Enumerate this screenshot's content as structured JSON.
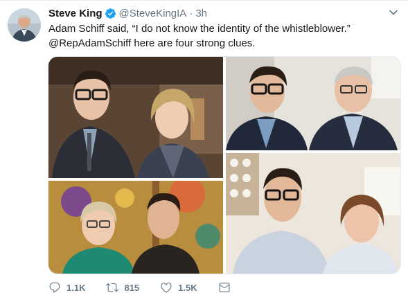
{
  "tweet": {
    "author_name": "Steve King",
    "handle": "@SteveKingIA",
    "separator": "·",
    "time": "3h",
    "verified": true,
    "text_line1": "Adam Schiff said, “I do not know the identity of the whistleblower.”",
    "mention": "@RepAdamSchiff",
    "text_line2_rest": " here are four strong clues.",
    "icons": {
      "verified": "verified-badge-icon",
      "menu": "chevron-down-icon",
      "reply": "reply-icon",
      "retweet": "retweet-icon",
      "like": "heart-icon",
      "dm": "envelope-icon"
    }
  },
  "actions": {
    "reply_count": "1.1K",
    "retweet_count": "815",
    "like_count": "1.5K"
  },
  "colors": {
    "accent": "#1da1f2",
    "secondary_text": "#657786",
    "primary_text": "#14171a"
  }
}
